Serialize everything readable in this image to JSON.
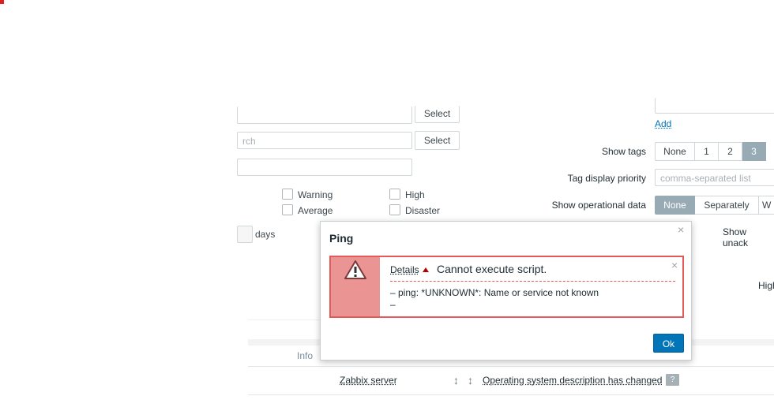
{
  "filter": {
    "select_btn_1": "Select",
    "search_placeholder": "rch",
    "select_btn_2": "Select",
    "severities": {
      "warning": "Warning",
      "high": "High",
      "average": "Average",
      "disaster": "Disaster"
    },
    "days_label": "days",
    "add_link": "Add",
    "show_tags_label": "Show tags",
    "show_tags_options": [
      "None",
      "1",
      "2",
      "3"
    ],
    "show_tags_selected": "3",
    "tag_priority_label": "Tag display priority",
    "tag_priority_placeholder": "comma-separated list",
    "show_opdata_label": "Show operational data",
    "show_opdata_options": [
      "None",
      "Separately",
      "W"
    ],
    "show_opdata_selected": "None",
    "show_unack_label": "Show unack",
    "high_label_partial": "High"
  },
  "table": {
    "col_info": "Info",
    "row": {
      "host": "Zabbix server",
      "problem": "Operating system description has changed",
      "tag_badge": "?"
    }
  },
  "dialog": {
    "title": "Ping",
    "close_glyph": "×",
    "message": {
      "details_label": "Details",
      "title": "Cannot execute script.",
      "lines": [
        "–  ping: *UNKNOWN*: Name or service not known",
        "–"
      ],
      "close_glyph": "×"
    },
    "ok_label": "Ok"
  },
  "colors": {
    "accent": "#0275b8",
    "error_border": "#e45959",
    "error_icon_bg": "#eb9494",
    "segment_active": "#98abb4"
  }
}
